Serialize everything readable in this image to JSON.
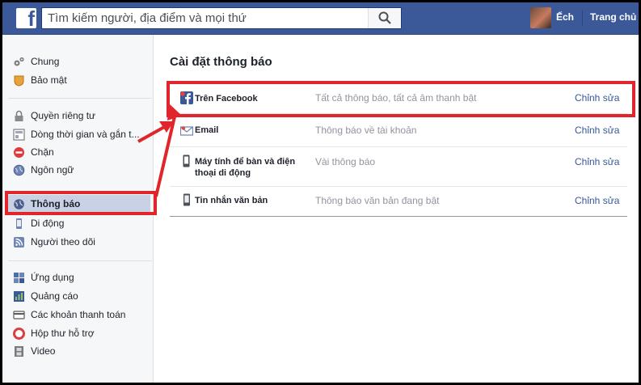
{
  "topbar": {
    "logo_letter": "f",
    "search_placeholder": "Tìm kiếm người, địa điểm và mọi thứ",
    "username": "Ếch",
    "home_label": "Trang chủ"
  },
  "sidebar": {
    "groups": [
      [
        {
          "label": "Chung",
          "icon": "gears-icon"
        },
        {
          "label": "Bảo mật",
          "icon": "shield-icon"
        }
      ],
      [
        {
          "label": "Quyền riêng tư",
          "icon": "lock-icon"
        },
        {
          "label": "Dòng thời gian và gắn t...",
          "icon": "timeline-icon"
        },
        {
          "label": "Chặn",
          "icon": "block-icon"
        },
        {
          "label": "Ngôn ngữ",
          "icon": "globe-icon"
        }
      ],
      [
        {
          "label": "Thông báo",
          "icon": "globe-notifications-icon",
          "active": true
        },
        {
          "label": "Di động",
          "icon": "mobile-icon"
        },
        {
          "label": "Người theo dõi",
          "icon": "rss-icon"
        }
      ],
      [
        {
          "label": "Ứng dụng",
          "icon": "apps-icon"
        },
        {
          "label": "Quảng cáo",
          "icon": "ads-icon"
        },
        {
          "label": "Các khoản thanh toán",
          "icon": "card-icon"
        },
        {
          "label": "Hộp thư hỗ trợ",
          "icon": "lifebuoy-icon"
        },
        {
          "label": "Video",
          "icon": "film-icon"
        }
      ]
    ]
  },
  "main": {
    "title": "Cài đặt thông báo",
    "rows": [
      {
        "name": "Trên Facebook",
        "desc": "Tất cả thông báo, tất cả âm thanh bật",
        "edit": "Chỉnh sửa",
        "icon": "facebook-icon"
      },
      {
        "name": "Email",
        "desc": "Thông báo về tài khoản",
        "edit": "Chỉnh sửa",
        "icon": "email-icon"
      },
      {
        "name": "Máy tính để bàn và điện thoại di động",
        "desc": "Vài thông báo",
        "edit": "Chỉnh sửa",
        "icon": "desktop-mobile-icon"
      },
      {
        "name": "Tin nhắn văn bản",
        "desc": "Thông báo văn bản đang bật",
        "edit": "Chỉnh sửa",
        "icon": "sms-icon"
      }
    ]
  },
  "colors": {
    "brand": "#3b5998",
    "link": "#365899",
    "highlight": "#e0262a",
    "active_bg": "#c9d1e4"
  }
}
